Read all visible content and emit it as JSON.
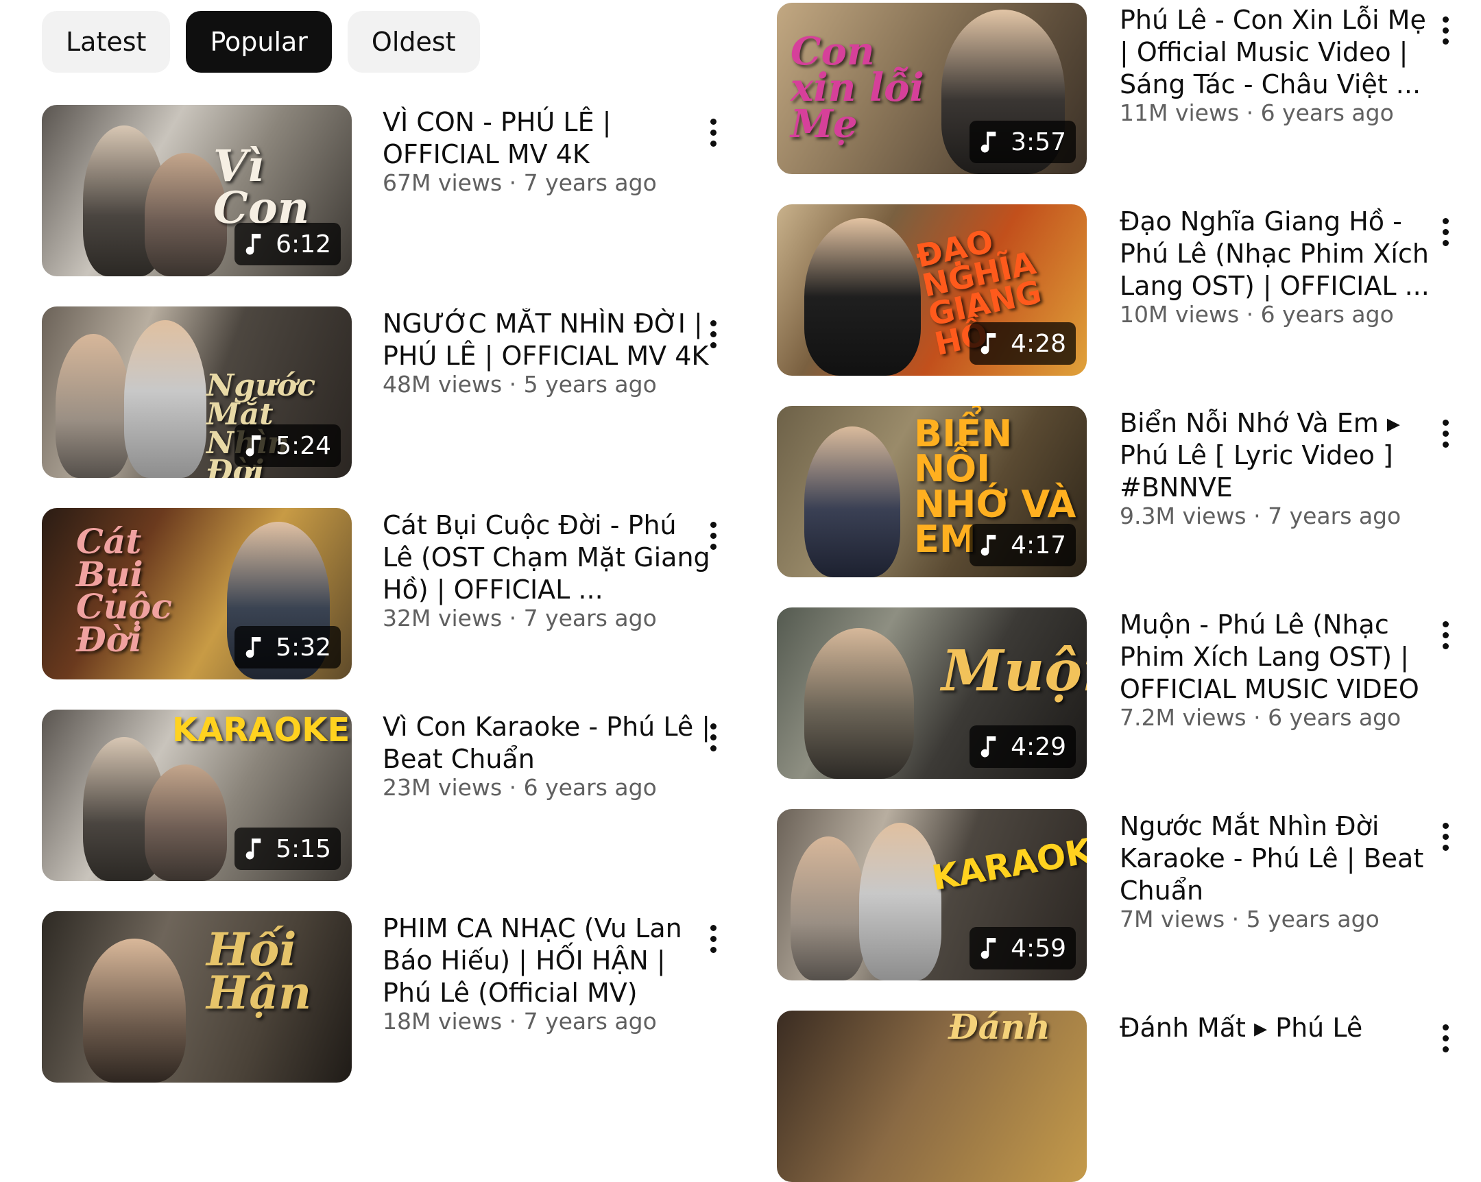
{
  "filters": {
    "chips": [
      {
        "label": "Latest",
        "active": false
      },
      {
        "label": "Popular",
        "active": true
      },
      {
        "label": "Oldest",
        "active": false
      }
    ]
  },
  "left_videos": [
    {
      "title": "VÌ CON - PHÚ LÊ | OFFICIAL MV 4K",
      "stats": "67M views · 7 years ago",
      "duration": "6:12",
      "thumb_text": "Vì Con"
    },
    {
      "title": "NGƯỚC MẮT NHÌN ĐỜI | PHÚ LÊ | OFFICIAL MV 4K",
      "stats": "48M views · 5 years ago",
      "duration": "5:24",
      "thumb_text": "Ngước Mắt Nhìn Đời"
    },
    {
      "title": "Cát Bụi Cuộc Đời - Phú Lê (OST Chạm Mặt Giang Hồ) | OFFICIAL ...",
      "stats": "32M views · 7 years ago",
      "duration": "5:32",
      "thumb_text": "Cát Bụi Cuộc Đời"
    },
    {
      "title": "Vì Con Karaoke - Phú Lê | Beat Chuẩn",
      "stats": "23M views · 6 years ago",
      "duration": "5:15",
      "thumb_text": "KARAOKE"
    },
    {
      "title": "PHIM CA NHẠC (Vu Lan Báo Hiếu) | HỐI HẬN | Phú Lê (Official MV)",
      "stats": "18M views · 7 years ago",
      "duration": "",
      "thumb_text": "Hối Hận"
    }
  ],
  "right_videos": [
    {
      "title": "Phú Lê - Con Xin Lỗi Mẹ | Official Music Video | Sáng Tác - Châu Việt ...",
      "stats": "11M views · 6 years ago",
      "duration": "3:57",
      "thumb_text": "Con xin lỗi Mẹ"
    },
    {
      "title": "Đạo Nghĩa Giang Hồ - Phú Lê (Nhạc Phim Xích Lang OST) | OFFICIAL ...",
      "stats": "10M views · 6 years ago",
      "duration": "4:28",
      "thumb_text": "ĐẠO NGHĨA GIANG HỒ"
    },
    {
      "title": "Biển Nỗi Nhớ Và Em ▸ Phú Lê [ Lyric Video ] #BNNVE",
      "stats": "9.3M views · 7 years ago",
      "duration": "4:17",
      "thumb_text": "BIỂN NỖI NHỚ VÀ EM"
    },
    {
      "title": "Muộn - Phú Lê (Nhạc Phim Xích Lang OST) | OFFICIAL MUSIC VIDEO",
      "stats": "7.2M views · 6 years ago",
      "duration": "4:29",
      "thumb_text": "Muộn"
    },
    {
      "title": "Ngước Mắt Nhìn Đời Karaoke - Phú Lê | Beat Chuẩn",
      "stats": "7M views · 5 years ago",
      "duration": "4:59",
      "thumb_text": "KARAOKE"
    },
    {
      "title": "Đánh Mất ▸ Phú Lê",
      "stats": "",
      "duration": "",
      "thumb_text": "Đánh"
    }
  ],
  "icons": {
    "duration": "music-note-icon",
    "more": "more-vert-icon"
  },
  "colors": {
    "active_chip": "#0f0f0f",
    "chip": "#f2f2f2",
    "secondary_text": "#606060"
  }
}
